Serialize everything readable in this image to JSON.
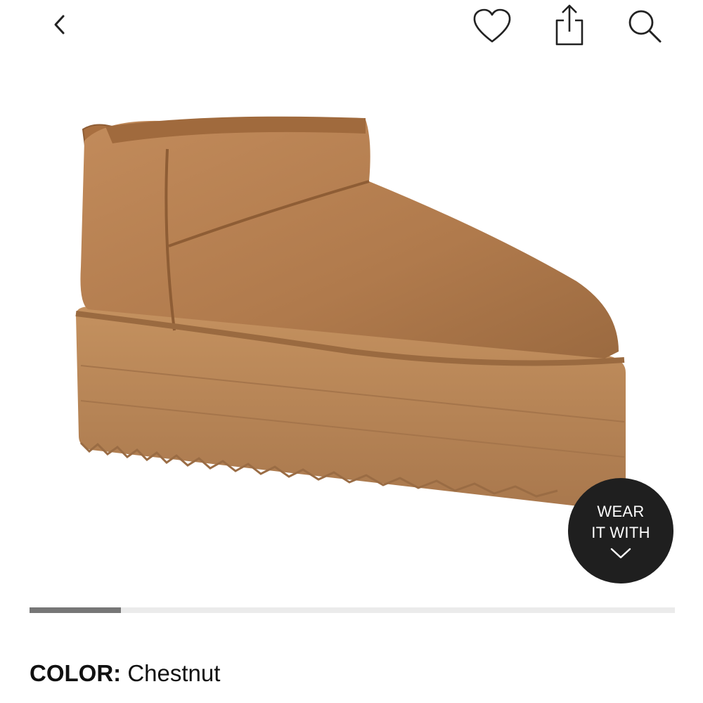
{
  "header": {
    "back_icon": "chevron-left-icon",
    "favorite_icon": "heart-icon",
    "share_icon": "share-icon",
    "search_icon": "search-icon"
  },
  "product_image": {
    "subject": "boot-icon",
    "colors": {
      "suede": "#b07a4c",
      "sole": "#b9865a",
      "shadow": "#8e5d35"
    }
  },
  "wear_it_with": {
    "line1": "WEAR",
    "line2": "IT WITH",
    "icon": "chevron-down-icon"
  },
  "gallery_progress": {
    "fraction": 0.142
  },
  "color": {
    "label": "COLOR:",
    "value": "Chestnut"
  }
}
